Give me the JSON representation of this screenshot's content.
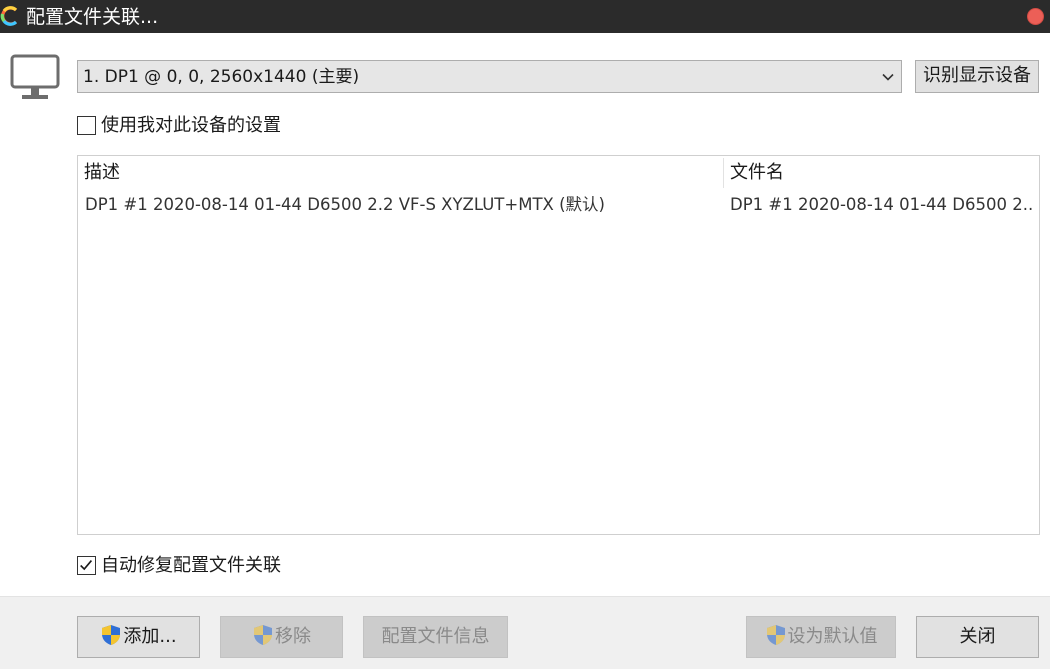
{
  "window": {
    "title": "配置文件关联...",
    "icon": "app-logo-icon",
    "close_color": "#ec5f57"
  },
  "display": {
    "selected": "1. DP1 @ 0, 0, 2560x1440 (主要)",
    "identify_label": "识别显示设备"
  },
  "use_settings": {
    "label": "使用我对此设备的设置",
    "checked": false
  },
  "profiles": {
    "columns": [
      "描述",
      "文件名"
    ],
    "rows": [
      {
        "description": "DP1 #1 2020-08-14 01-44 D6500 2.2 VF-S XYZLUT+MTX (默认)",
        "filename": "DP1 #1 2020-08-14 01-44 D6500 2...."
      }
    ]
  },
  "auto_fix": {
    "label": "自动修复配置文件关联",
    "checked": true
  },
  "buttons": {
    "add": "添加...",
    "remove": "移除",
    "profile_info": "配置文件信息",
    "set_default": "设为默认值",
    "close": "关闭"
  },
  "icons": {
    "monitor": "monitor-icon",
    "dropdown": "chevron-down-icon",
    "shield": "uac-shield-icon"
  }
}
